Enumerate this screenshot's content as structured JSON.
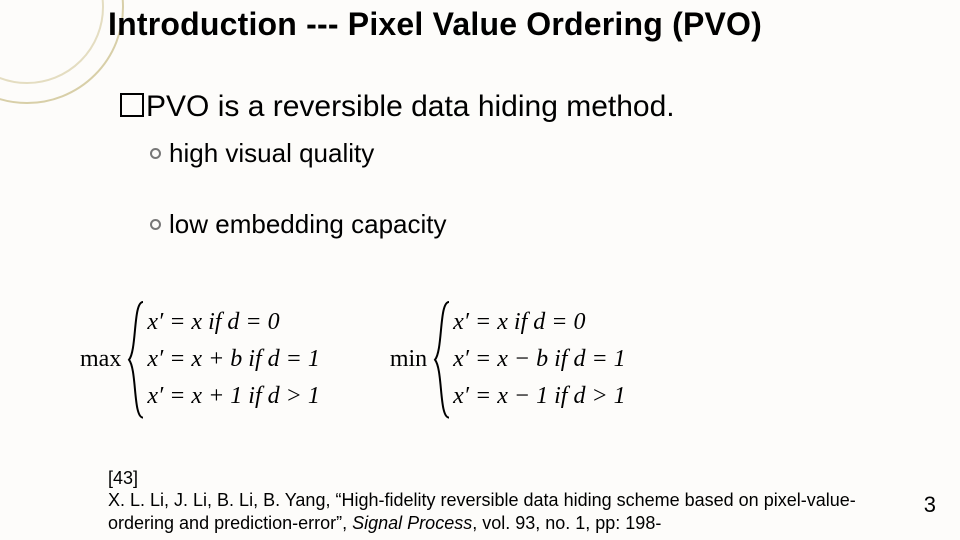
{
  "title": "Introduction ---  Pixel Value Ordering (PVO)",
  "headline": "PVO is a reversible data hiding method.",
  "subpoints": [
    "high visual quality",
    "low embedding capacity"
  ],
  "equations": {
    "max": {
      "label": "max",
      "lines": [
        {
          "lhs": "x′ = x",
          "cond": "if d = 0"
        },
        {
          "lhs": "x′ = x + b",
          "cond": "if d = 1"
        },
        {
          "lhs": "x′ = x + 1",
          "cond": "if d > 1"
        }
      ]
    },
    "min": {
      "label": "min",
      "lines": [
        {
          "lhs": "x′ = x",
          "cond": "if d = 0"
        },
        {
          "lhs": "x′ = x − b",
          "cond": "if d = 1"
        },
        {
          "lhs": "x′ = x − 1",
          "cond": "if d > 1"
        }
      ]
    }
  },
  "reference": {
    "num": "[43]",
    "authors": "X. L. Li, J. Li, B. Li, B. Yang,",
    "title_quoted": "“High-fidelity reversible data hiding scheme based on pixel-value-ordering and prediction-error”,",
    "journal": "Signal Process",
    "rest": ", vol. 93, no. 1, pp: 198-"
  },
  "page_number": "3"
}
